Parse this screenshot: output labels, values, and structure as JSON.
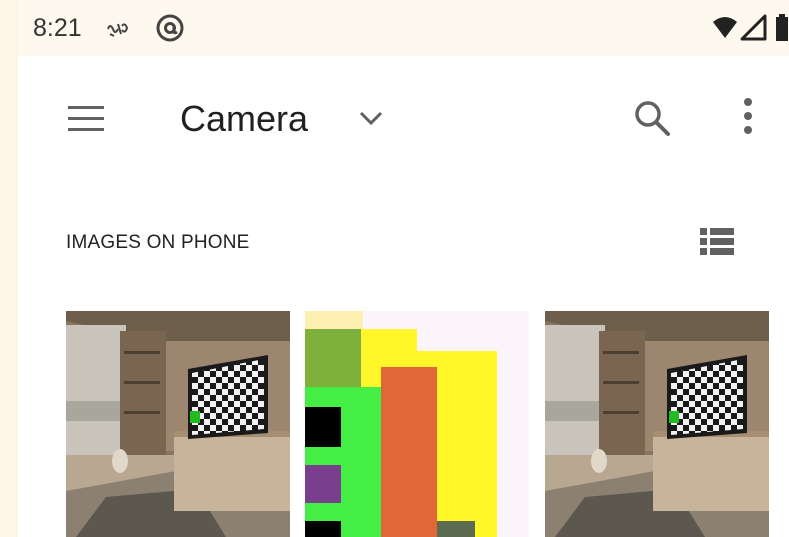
{
  "status_bar": {
    "time": "8:21",
    "icons": [
      "notification-icon",
      "at-sign-icon",
      "wifi-icon",
      "cell-signal-icon",
      "battery-icon"
    ]
  },
  "app_bar": {
    "title": "Camera",
    "icons": [
      "menu-icon",
      "chevron-down-icon",
      "search-icon",
      "more-vert-icon"
    ]
  },
  "section": {
    "label": "IMAGES ON PHONE",
    "view_toggle_icon": "list-view-icon"
  },
  "thumbnails": [
    {
      "kind": "photo",
      "subject": "living room with tv"
    },
    {
      "kind": "pixel-art"
    },
    {
      "kind": "photo",
      "subject": "living room with tv"
    }
  ],
  "colors": {
    "status_bar_bg": "#fdf9ef",
    "page_bg": "#ffffff",
    "text": "#212121",
    "icon": "#616161"
  }
}
